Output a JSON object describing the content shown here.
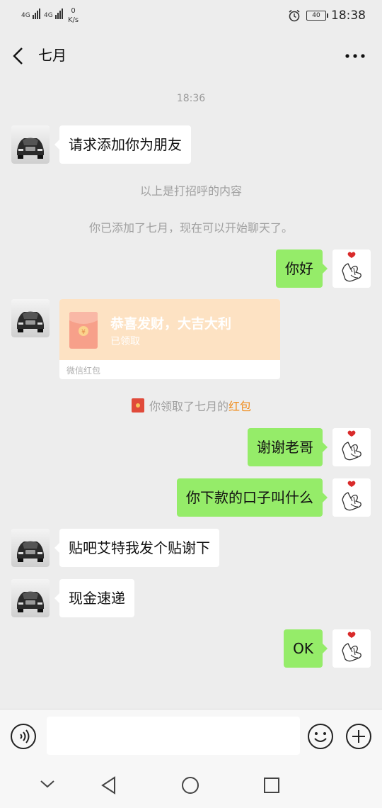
{
  "status_bar": {
    "network_1": "4G",
    "network_2": "4G",
    "speed_value": "0",
    "speed_unit": "K/s",
    "battery": "40",
    "time": "18:38"
  },
  "header": {
    "title": "七月",
    "back_icon": "chevron-left-icon",
    "more_icon": "more-dots-icon"
  },
  "messages": {
    "timestamp": "18:36",
    "m1": "请求添加你为朋友",
    "sys1": "以上是打招呼的内容",
    "sys2": "你已添加了七月，现在可以开始聊天了。",
    "m2": "你好",
    "red_packet": {
      "title": "恭喜发财，大吉大利",
      "status": "已领取",
      "footer": "微信红包"
    },
    "sys3_prefix": "你领取了七月的",
    "sys3_link": "红包",
    "m3": "谢谢老哥",
    "m4": "你下款的口子叫什么",
    "m5": "贴吧艾特我发个贴谢下",
    "m6": "现金速递",
    "m7": "OK"
  },
  "input_bar": {
    "voice_icon": "voice-icon",
    "emoji_icon": "emoji-icon",
    "plus_icon": "plus-icon"
  },
  "nav_bar": {
    "hide_icon": "chevron-down-icon",
    "back_icon": "triangle-back-icon",
    "home_icon": "circle-home-icon",
    "recent_icon": "square-recent-icon"
  },
  "colors": {
    "self_bubble": "#95ec69",
    "other_bubble": "#ffffff",
    "background": "#ededed",
    "red_packet": "#fde2c3",
    "link_orange": "#f08d1e"
  }
}
